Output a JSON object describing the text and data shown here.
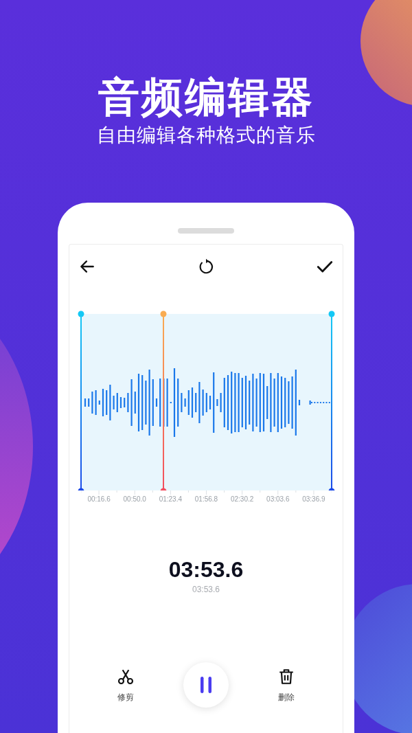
{
  "headline": "音频编辑器",
  "subtitle": "自由编辑各种格式的音乐",
  "editor": {
    "toolbar": [
      {
        "kind": "back"
      },
      {
        "kind": "reset"
      },
      {
        "kind": "confirm"
      }
    ],
    "playhead": {
      "level": 0.33
    },
    "time_labels": [
      "00:16.6",
      "00:50.0",
      "01:23.4",
      "01:56.8",
      "02:30.2",
      "03:03.6",
      "03:36.9"
    ],
    "duration": "03:53.6",
    "duration_sub": "03:53.6",
    "actions": [
      {
        "kind": "trim",
        "label": "修剪"
      },
      {
        "kind": "pause"
      },
      {
        "kind": "delete",
        "label": "删除"
      }
    ]
  }
}
